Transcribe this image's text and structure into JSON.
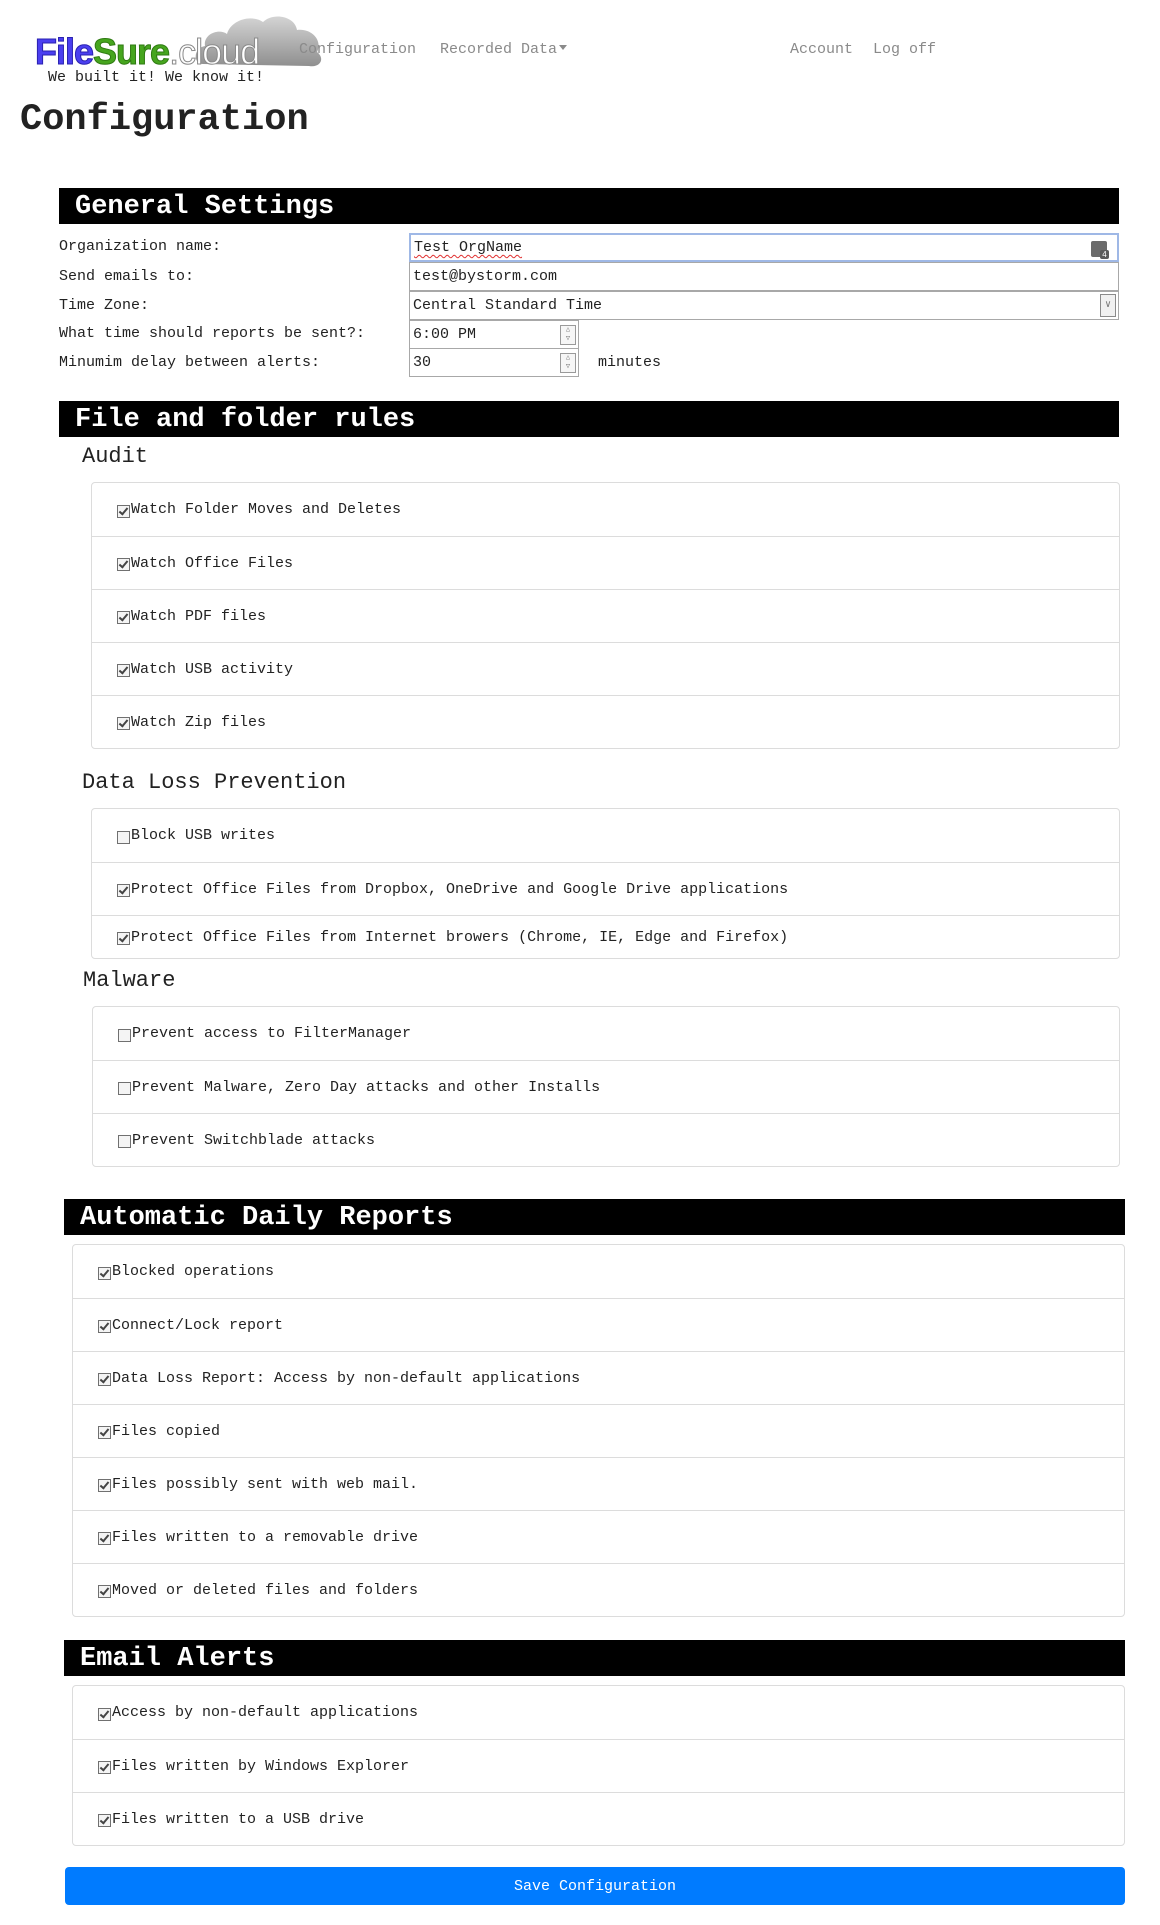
{
  "brand": {
    "logo_part1": "File",
    "logo_part2": "Sure",
    "logo_part3": ".cloud",
    "tagline": "We built it! We know it!"
  },
  "nav": {
    "configuration": "Configuration",
    "recorded_data": "Recorded Data",
    "account": "Account",
    "log_off": "Log off"
  },
  "page_title": "Configuration",
  "general_settings": {
    "heading": "General Settings",
    "org_name_label": "Organization name:",
    "org_name_value": "Test OrgName",
    "send_emails_label": "Send emails to:",
    "send_emails_value": "test@bystorm.com",
    "time_zone_label": "Time Zone:",
    "time_zone_value": "Central Standard Time",
    "report_time_label": "What time should reports be sent?:",
    "report_time_value": "6:00 PM",
    "min_delay_label": "Minumim delay between alerts:",
    "min_delay_value": "30",
    "min_delay_unit": "minutes",
    "keyboard_badge": "4"
  },
  "file_folder_rules": {
    "heading": "File and folder rules",
    "audit": {
      "title": "Audit",
      "items": [
        {
          "label": "Watch Folder Moves and Deletes",
          "checked": true
        },
        {
          "label": "Watch Office Files",
          "checked": true
        },
        {
          "label": "Watch PDF files",
          "checked": true
        },
        {
          "label": "Watch USB activity",
          "checked": true
        },
        {
          "label": "Watch Zip files",
          "checked": true
        }
      ]
    },
    "dlp": {
      "title": "Data Loss Prevention",
      "items": [
        {
          "label": "Block USB writes",
          "checked": false
        },
        {
          "label": "Protect Office Files from Dropbox, OneDrive and Google Drive applications",
          "checked": true
        },
        {
          "label": "Protect Office Files from Internet browers (Chrome, IE, Edge and Firefox)",
          "checked": true
        }
      ]
    },
    "malware": {
      "title": "Malware",
      "items": [
        {
          "label": "Prevent access to FilterManager",
          "checked": false
        },
        {
          "label": "Prevent Malware, Zero Day attacks and other Installs",
          "checked": false
        },
        {
          "label": "Prevent Switchblade attacks",
          "checked": false
        }
      ]
    }
  },
  "daily_reports": {
    "heading": "Automatic Daily Reports",
    "items": [
      {
        "label": "Blocked operations",
        "checked": true
      },
      {
        "label": "Connect/Lock report",
        "checked": true
      },
      {
        "label": "Data Loss Report: Access by non-default applications",
        "checked": true
      },
      {
        "label": "Files copied",
        "checked": true
      },
      {
        "label": "Files possibly sent with web mail.",
        "checked": true
      },
      {
        "label": "Files written to a removable drive",
        "checked": true
      },
      {
        "label": "Moved or deleted files and folders",
        "checked": true
      }
    ]
  },
  "email_alerts": {
    "heading": "Email Alerts",
    "items": [
      {
        "label": "Access by non-default applications",
        "checked": true
      },
      {
        "label": "Files written by Windows Explorer",
        "checked": true
      },
      {
        "label": "Files written to a USB drive",
        "checked": true
      }
    ]
  },
  "save_label": "Save Configuration",
  "colors": {
    "section_header_bg": "#000000",
    "primary_button": "#007bff",
    "nav_link": "#8a8a8a"
  }
}
